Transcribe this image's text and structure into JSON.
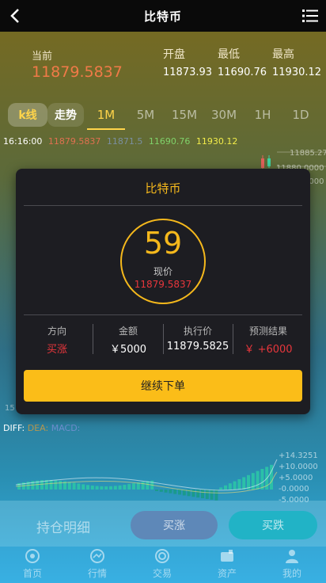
{
  "header": {
    "title": "比特币",
    "back_icon": "chevron-left-icon",
    "menu_icon": "list-icon"
  },
  "quote": {
    "current_label": "当前",
    "current_price": "11879.5837",
    "open_label": "开盘",
    "open_value": "11873.93",
    "low_label": "最低",
    "low_value": "11690.76",
    "high_label": "最高",
    "high_value": "11930.12"
  },
  "tabs": [
    "k线",
    "走势",
    "1M",
    "5M",
    "15M",
    "30M",
    "1H",
    "1D"
  ],
  "active_tab": "1M",
  "ohlc_row": {
    "time": "16:16:00",
    "open": "11879.5837",
    "close": "11871.5",
    "low": "11690.76",
    "high": "11930.12"
  },
  "chart": {
    "price_ticks": [
      "11885.2700",
      "11880.0000",
      "11875.0000"
    ],
    "left_tick": "15",
    "diff_label": "DIFF:",
    "dea_label": "DEA:",
    "macd_label": "MACD:",
    "macd_ticks": [
      "+14.3251",
      "+10.0000",
      "+5.0000",
      "-0.0000",
      "-5.0000"
    ]
  },
  "modal": {
    "title": "比特币",
    "countdown": "59",
    "now_label": "现价",
    "now_price": "11879.5837",
    "direction_label": "方向",
    "direction_value": "买涨",
    "amount_label": "金额",
    "amount_value": "￥5000",
    "exec_label": "执行价",
    "exec_value": "11879.5825",
    "predict_label": "预测结果",
    "predict_value": "￥ +6000",
    "continue_label": "继续下单"
  },
  "actions": {
    "hold_label": "持仓明细",
    "rise_label": "买涨",
    "fall_label": "买跌"
  },
  "nav": [
    {
      "label": "首页",
      "icon": "home-icon"
    },
    {
      "label": "行情",
      "icon": "chart-icon"
    },
    {
      "label": "交易",
      "icon": "trade-icon"
    },
    {
      "label": "资产",
      "icon": "wallet-icon"
    },
    {
      "label": "我的",
      "icon": "user-icon"
    }
  ],
  "colors": {
    "accent": "#f5b81c",
    "rise": "#e8363c",
    "fall": "#21b3c6",
    "price": "#f07a48"
  }
}
